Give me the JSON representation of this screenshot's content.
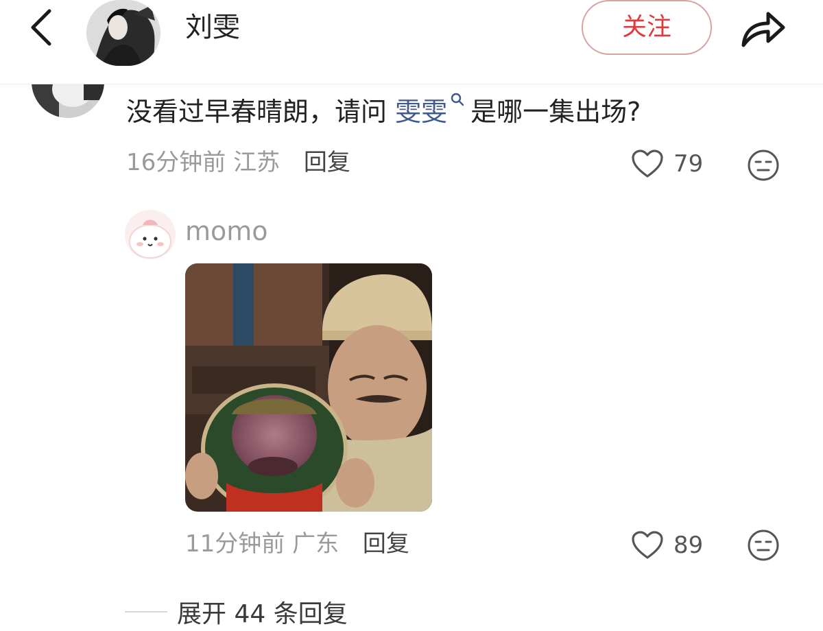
{
  "header": {
    "back_icon": "chevron-left-icon",
    "name": "刘雯",
    "follow_label": "关注",
    "share_icon": "share-arrow-icon",
    "accent_color": "#e0393e"
  },
  "comment": {
    "text_before": "没看过早春晴朗，请问 ",
    "mention": "雯雯",
    "text_after": "是哪一集出场?",
    "time": "16分钟前",
    "location": "江苏",
    "reply_label": "回复",
    "likes": "79"
  },
  "reply": {
    "username": "momo",
    "time": "11分钟前",
    "location": "广东",
    "reply_label": "回复",
    "likes": "89"
  },
  "expand_label": "展开 44 条回复"
}
